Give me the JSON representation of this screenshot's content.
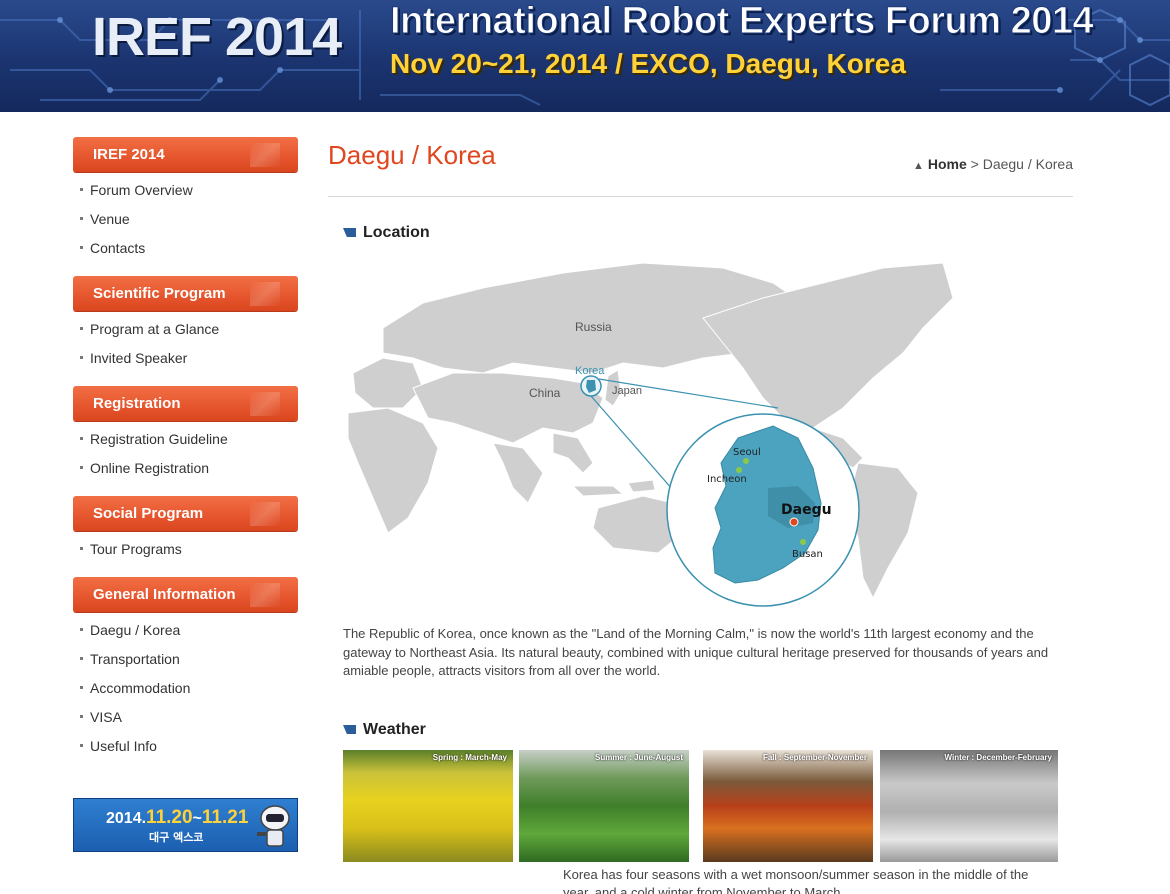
{
  "banner": {
    "logo": "IREF 2014",
    "title": "International Robot Experts Forum 2014",
    "subtitle": "Nov 20~21, 2014 / EXCO, Daegu, Korea"
  },
  "sidebar": {
    "sections": [
      {
        "label": "IREF 2014",
        "items": [
          "Forum Overview",
          "Venue",
          "Contacts"
        ]
      },
      {
        "label": "Scientific Program",
        "items": [
          "Program at a Glance",
          "Invited Speaker"
        ]
      },
      {
        "label": "Registration",
        "items": [
          "Registration Guideline",
          "Online Registration"
        ]
      },
      {
        "label": "Social Program",
        "items": [
          "Tour Programs"
        ]
      },
      {
        "label": "General Information",
        "items": [
          "Daegu / Korea",
          "Transportation",
          "Accommodation",
          "VISA",
          "Useful Info"
        ]
      }
    ],
    "promo": {
      "date_prefix": "2014.",
      "date_start": "11.20",
      "date_sep": "~",
      "date_end": "11.21",
      "venue": "대구 엑스코"
    }
  },
  "main": {
    "title": "Daegu / Korea",
    "breadcrumb": {
      "home": "Home",
      "sep": ">",
      "current": "Daegu / Korea"
    },
    "location": {
      "heading": "Location",
      "map_labels": {
        "russia": "Russia",
        "china": "China",
        "korea": "Korea",
        "japan": "Japan",
        "seoul": "Seoul",
        "incheon": "Incheon",
        "daegu": "Daegu",
        "busan": "Busan"
      },
      "description": "The Republic of Korea, once known as the \"Land of the Morning Calm,\" is now the world's 11th largest economy and the gateway to Northeast Asia. Its natural beauty, combined with unique cultural heritage preserved for thousands of years and amiable people, attracts visitors from all over the world."
    },
    "weather": {
      "heading": "Weather",
      "seasons": [
        {
          "caption": "Spring : March-May"
        },
        {
          "caption": "Summer : June-August"
        },
        {
          "caption": "Fall : September-November"
        },
        {
          "caption": "Winter : December-February"
        }
      ],
      "text": "Korea has four seasons with a wet monsoon/summer season in the middle of the year, and a cold winter from November to March."
    }
  }
}
